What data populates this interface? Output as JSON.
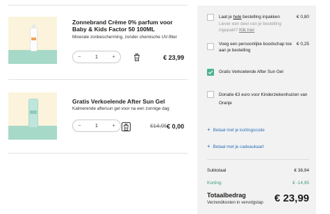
{
  "products": [
    {
      "title": "Zonnebrand Crème 0% parfum voor Baby & Kids Factor 50 100ML",
      "subtitle": "Minerale zonbescherming, zonder chemische UV-filter",
      "quantity": "1",
      "price": "€ 23,99",
      "old_price": ""
    },
    {
      "title": "Gratis Verkoelende After Sun Gel",
      "subtitle": "Kalmerende aftersun gel voor na een zonnige dag",
      "quantity": "1",
      "price": "€ 0,00",
      "old_price": "€14,95"
    }
  ],
  "stepper": {
    "minus": "−",
    "plus": "+"
  },
  "summary": {
    "options": [
      {
        "label_pre": "Laat je ",
        "label_u": "hele",
        "label_post": " bestelling inpakken",
        "note": "Liever een deel van je bestelling ingepakt?",
        "note_link": "Klik hier",
        "price": "€ 0,80",
        "checked": false
      },
      {
        "label": "Voeg een persoonlijke boodschap toe aan je bestelling",
        "price": "€ 0,25",
        "checked": false
      },
      {
        "label": "Gratis Verkoelende After Sun Gel",
        "checked": true
      },
      {
        "label": "Donatie €3 euro voor Kinderziekenhuizen van Oranje",
        "checked": false
      }
    ],
    "links": {
      "discount": "Betaal met je kortingscode",
      "giftcard": "Betaal met je cadeaukaart",
      "plus": "+"
    },
    "subtotal_label": "Subtotaal",
    "subtotal_value": "€ 38,94",
    "discount_label": "Korting",
    "discount_value": "€ -14,95",
    "total_label": "Totaalbedrag",
    "total_note": "Verzendkosten in vervolgstap",
    "total_value": "€ 23,99"
  },
  "colors": {
    "accent_green": "#4db38d",
    "link_blue": "#2d6fb8",
    "panel_bg": "#f2f2f2"
  }
}
